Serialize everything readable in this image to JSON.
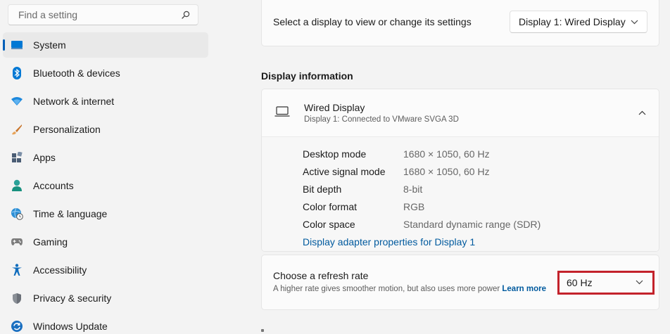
{
  "search": {
    "placeholder": "Find a setting",
    "icon": "search-icon"
  },
  "sidebar": {
    "selected_index": 0,
    "accent_color": "#005fb8",
    "items": [
      {
        "label": "System",
        "icon": "system-icon"
      },
      {
        "label": "Bluetooth & devices",
        "icon": "bluetooth-icon"
      },
      {
        "label": "Network & internet",
        "icon": "network-icon"
      },
      {
        "label": "Personalization",
        "icon": "brush-icon"
      },
      {
        "label": "Apps",
        "icon": "apps-icon"
      },
      {
        "label": "Accounts",
        "icon": "accounts-icon"
      },
      {
        "label": "Time & language",
        "icon": "globe-clock-icon"
      },
      {
        "label": "Gaming",
        "icon": "gamepad-icon"
      },
      {
        "label": "Accessibility",
        "icon": "accessibility-icon"
      },
      {
        "label": "Privacy & security",
        "icon": "shield-icon"
      },
      {
        "label": "Windows Update",
        "icon": "windows-update-icon"
      }
    ]
  },
  "display_select": {
    "label": "Select a display to view or change its settings",
    "value": "Display 1: Wired Display"
  },
  "display_info": {
    "section_title": "Display information",
    "title": "Wired Display",
    "subtitle": "Display 1: Connected to VMware SVGA 3D",
    "rows": [
      {
        "key": "Desktop mode",
        "value": "1680 × 1050, 60 Hz"
      },
      {
        "key": "Active signal mode",
        "value": "1680 × 1050, 60 Hz"
      },
      {
        "key": "Bit depth",
        "value": "8-bit"
      },
      {
        "key": "Color format",
        "value": "RGB"
      },
      {
        "key": "Color space",
        "value": "Standard dynamic range (SDR)"
      }
    ],
    "adapter_link": "Display adapter properties for Display 1"
  },
  "refresh_rate": {
    "title": "Choose a refresh rate",
    "description": "A higher rate gives smoother motion, but also uses more power",
    "learn_more": "Learn more",
    "value": "60 Hz",
    "highlight_color": "#c3222b"
  }
}
